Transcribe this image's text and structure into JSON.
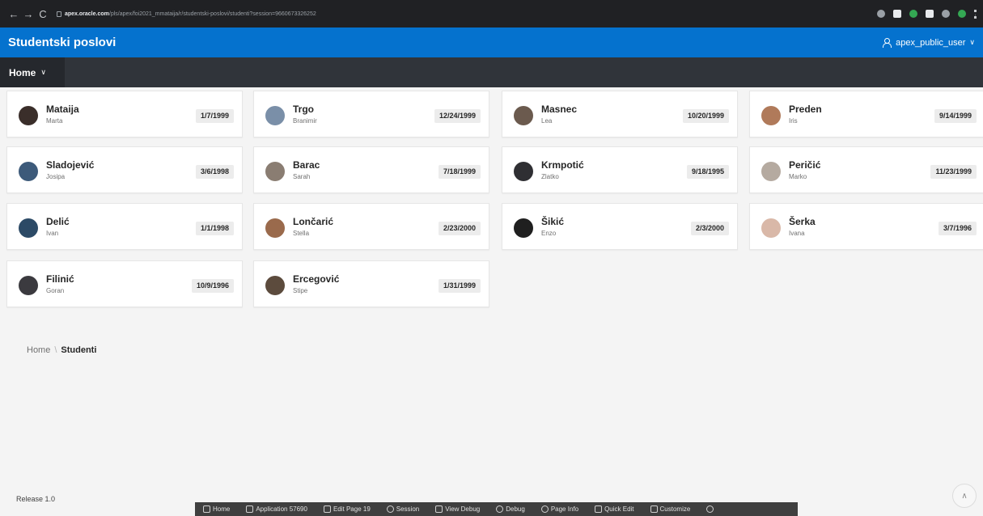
{
  "browser": {
    "host": "apex.oracle.com",
    "path": "/pls/apex/foi2021_mmataija/r/studentski-poslovi/studenti?session=9660673326252"
  },
  "header": {
    "app_title": "Studentski poslovi",
    "user_label": "apex_public_user"
  },
  "nav": {
    "home_label": "Home"
  },
  "cards": [
    {
      "surname": "Mataija",
      "firstname": "Marta",
      "date": "1/7/1999",
      "avatar_color": "#3a2e2a"
    },
    {
      "surname": "Trgo",
      "firstname": "Branimir",
      "date": "12/24/1999",
      "avatar_color": "#7a8fa8"
    },
    {
      "surname": "Masnec",
      "firstname": "Lea",
      "date": "10/20/1999",
      "avatar_color": "#6b5a4e"
    },
    {
      "surname": "Preden",
      "firstname": "Iris",
      "date": "9/14/1999",
      "avatar_color": "#b07a5a"
    },
    {
      "surname": "Sladojević",
      "firstname": "Josipa",
      "date": "3/6/1998",
      "avatar_color": "#3d5a7a"
    },
    {
      "surname": "Barac",
      "firstname": "Sarah",
      "date": "7/18/1999",
      "avatar_color": "#8a7d72"
    },
    {
      "surname": "Krmpotić",
      "firstname": "Zlatko",
      "date": "9/18/1995",
      "avatar_color": "#2f2f33"
    },
    {
      "surname": "Peričić",
      "firstname": "Marko",
      "date": "11/23/1999",
      "avatar_color": "#b5aaa0"
    },
    {
      "surname": "Delić",
      "firstname": "Ivan",
      "date": "1/1/1998",
      "avatar_color": "#2c4a66"
    },
    {
      "surname": "Lončarić",
      "firstname": "Stella",
      "date": "2/23/2000",
      "avatar_color": "#9a6a4c"
    },
    {
      "surname": "Šikić",
      "firstname": "Enzo",
      "date": "2/3/2000",
      "avatar_color": "#1f1f1f"
    },
    {
      "surname": "Šerka",
      "firstname": "Ivana",
      "date": "3/7/1996",
      "avatar_color": "#d9b8a8"
    },
    {
      "surname": "Filinić",
      "firstname": "Goran",
      "date": "10/9/1996",
      "avatar_color": "#3b3a3f"
    },
    {
      "surname": "Ercegović",
      "firstname": "Stipe",
      "date": "1/31/1999",
      "avatar_color": "#5c4b3d"
    }
  ],
  "breadcrumb": {
    "home": "Home",
    "current": "Studenti"
  },
  "footer": {
    "release": "Release 1.0"
  },
  "dev_toolbar": [
    {
      "label": "Home",
      "icon": "home-icon"
    },
    {
      "label": "Application 57690",
      "icon": "edit-icon"
    },
    {
      "label": "Edit Page 19",
      "icon": "page-edit-icon"
    },
    {
      "label": "Session",
      "icon": "clock-icon"
    },
    {
      "label": "View Debug",
      "icon": "view-debug-icon"
    },
    {
      "label": "Debug",
      "icon": "bug-icon"
    },
    {
      "label": "Page Info",
      "icon": "info-icon"
    },
    {
      "label": "Quick Edit",
      "icon": "quick-edit-icon"
    },
    {
      "label": "Customize",
      "icon": "brush-icon"
    },
    {
      "label": "",
      "icon": "gear-icon"
    }
  ],
  "colors": {
    "brand": "#0572ce",
    "nav": "#30343a",
    "toolbar": "#3f3f3f"
  }
}
